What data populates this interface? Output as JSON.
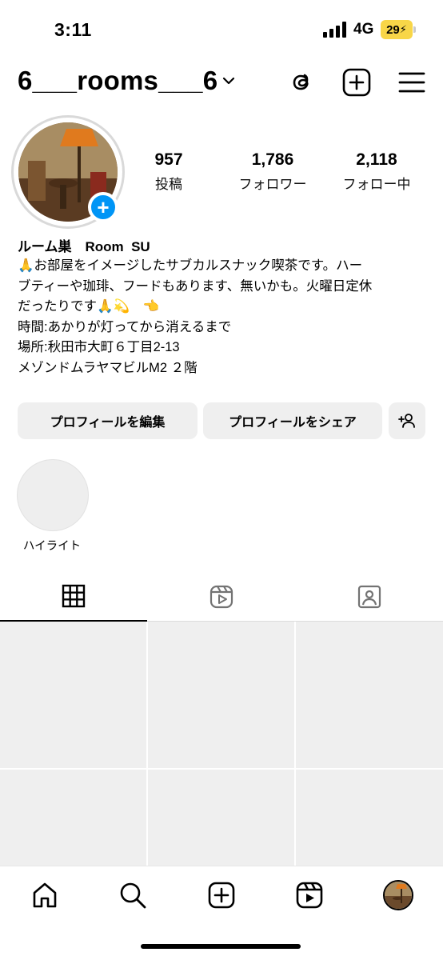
{
  "status_bar": {
    "time": "3:11",
    "network": "4G",
    "battery": "29",
    "battery_color": "#f8d648"
  },
  "header": {
    "username": "6___rooms___6",
    "icons": [
      "chevron-down-icon",
      "threads-icon",
      "create-plus-icon",
      "menu-icon"
    ]
  },
  "profile": {
    "stats": [
      {
        "value": "957",
        "label": "投稿"
      },
      {
        "value": "1,786",
        "label": "フォロワー"
      },
      {
        "value": "2,118",
        "label": "フォロー中"
      }
    ],
    "display_name": "ルーム巣　Room  SU",
    "bio_lines": [
      "🙏お部屋をイメージしたサブカルスナック喫茶です。ハー",
      "ブティーや珈琲、フードもあります、無いかも。火曜日定休",
      "だったりです🙏💫　👈",
      "時間:あかりが灯ってから消えるまで",
      "場所:秋田市大町６丁目2-13",
      "メゾンドムラヤマビルM2 ２階"
    ]
  },
  "buttons": {
    "edit_profile": "プロフィールを編集",
    "share_profile": "プロフィールをシェア"
  },
  "highlights": {
    "label": "ハイライト"
  },
  "tabs": [
    "grid-icon",
    "reels-icon",
    "tagged-icon"
  ],
  "bottom_nav": [
    "home-icon",
    "search-icon",
    "create-icon",
    "reels-icon",
    "profile-avatar"
  ],
  "colors": {
    "accent_blue": "#0095f6",
    "button_bg": "#efefef"
  }
}
